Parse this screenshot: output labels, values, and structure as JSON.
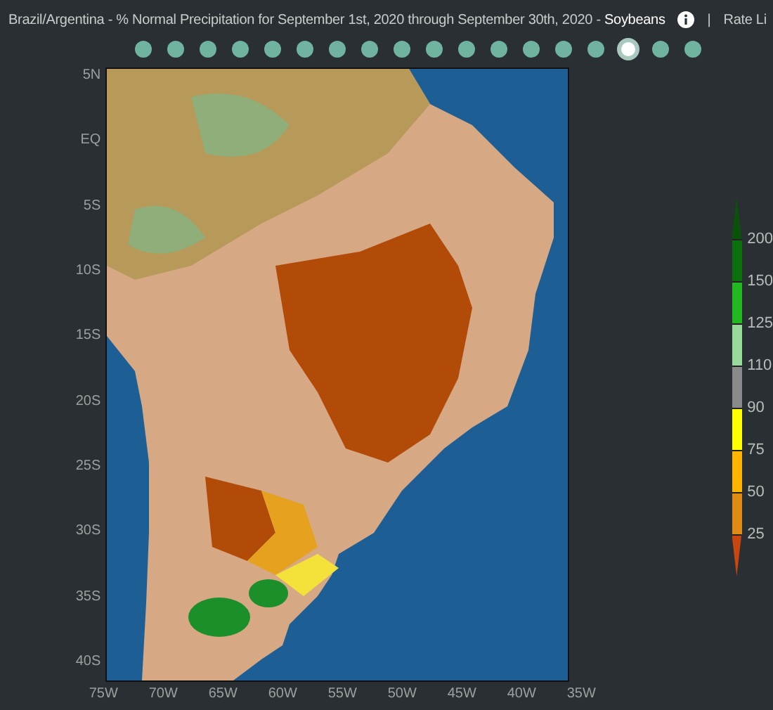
{
  "header": {
    "title": "Brazil/Argentina - % Normal Precipitation for September 1st, 2020 through September 30th, 2020 - **Soybeans**",
    "separator": "|",
    "link": "Rate Li"
  },
  "timeline": [
    {
      "selected": false
    },
    {
      "selected": false
    },
    {
      "selected": false
    },
    {
      "selected": false
    },
    {
      "selected": false
    },
    {
      "selected": false
    },
    {
      "selected": false
    },
    {
      "selected": false
    },
    {
      "selected": false
    },
    {
      "selected": false
    },
    {
      "selected": false
    },
    {
      "selected": false
    },
    {
      "selected": false
    },
    {
      "selected": false
    },
    {
      "selected": false
    },
    {
      "selected": true
    },
    {
      "selected": false
    },
    {
      "selected": false
    }
  ],
  "map": {
    "lat_labels": [
      "5N",
      "EQ",
      "5S",
      "10S",
      "15S",
      "20S",
      "25S",
      "30S",
      "35S",
      "40S"
    ],
    "lon_labels": [
      "75W",
      "70W",
      "65W",
      "60W",
      "55W",
      "50W",
      "45W",
      "40W",
      "35W"
    ]
  },
  "legend": {
    "segments": [
      {
        "color": "#0a520a"
      },
      {
        "color": "#0b700b"
      },
      {
        "color": "#22b822"
      },
      {
        "color": "#98d898"
      },
      {
        "color": "#8a8a8a"
      },
      {
        "color": "#ffff00"
      },
      {
        "color": "#ffb400"
      },
      {
        "color": "#de8a14"
      },
      {
        "color": "#c8460f"
      }
    ],
    "labels": [
      "200",
      "150",
      "125",
      "110",
      "90",
      "75",
      "50",
      "25"
    ]
  }
}
